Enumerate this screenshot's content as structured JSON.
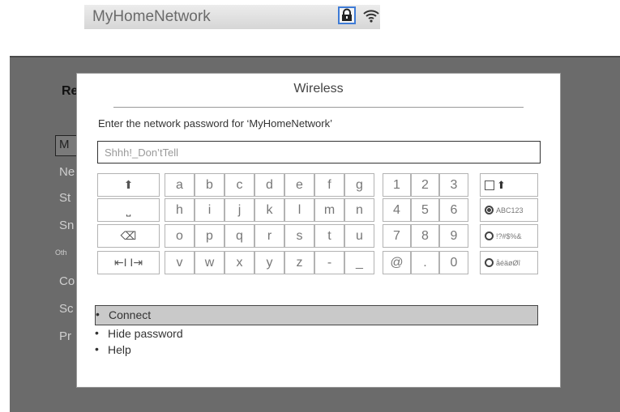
{
  "network_banner": {
    "name": "MyHomeNetwork",
    "lock_icon": "lock-icon",
    "wifi_icon": "wifi-icon"
  },
  "background_menu": {
    "title": "Re",
    "items": [
      "M",
      "Ne",
      "St",
      "Sn",
      "Oth",
      "Co",
      "Sc",
      "Pr"
    ]
  },
  "dialog": {
    "title": "Wireless",
    "prompt": "Enter the network password for ‘MyHomeNetwork’",
    "password_value": "Shhh!_Don’tTell"
  },
  "keyboard": {
    "function_keys": [
      "⬆",
      "⎵",
      "⌫",
      "⇤I I⇥"
    ],
    "letter_rows": [
      [
        "a",
        "b",
        "c",
        "d",
        "e",
        "f",
        "g"
      ],
      [
        "h",
        "i",
        "j",
        "k",
        "l",
        "m",
        "n"
      ],
      [
        "o",
        "p",
        "q",
        "r",
        "s",
        "t",
        "u"
      ],
      [
        "v",
        "w",
        "x",
        "y",
        "z",
        "-",
        "_"
      ]
    ],
    "number_rows": [
      [
        "1",
        "2",
        "3"
      ],
      [
        "4",
        "5",
        "6"
      ],
      [
        "7",
        "8",
        "9"
      ],
      [
        "@",
        ".",
        "0"
      ]
    ],
    "options": [
      {
        "label": "⬆",
        "type": "checkbox",
        "checked": false
      },
      {
        "label": "ABC123",
        "type": "radio",
        "checked": true
      },
      {
        "label": "!?#$%&",
        "type": "radio",
        "checked": false
      },
      {
        "label": "åéäøØî",
        "type": "radio",
        "checked": false
      }
    ]
  },
  "actions": [
    {
      "label": "Connect",
      "selected": true
    },
    {
      "label": "Hide password",
      "selected": false
    },
    {
      "label": "Help",
      "selected": false
    }
  ]
}
